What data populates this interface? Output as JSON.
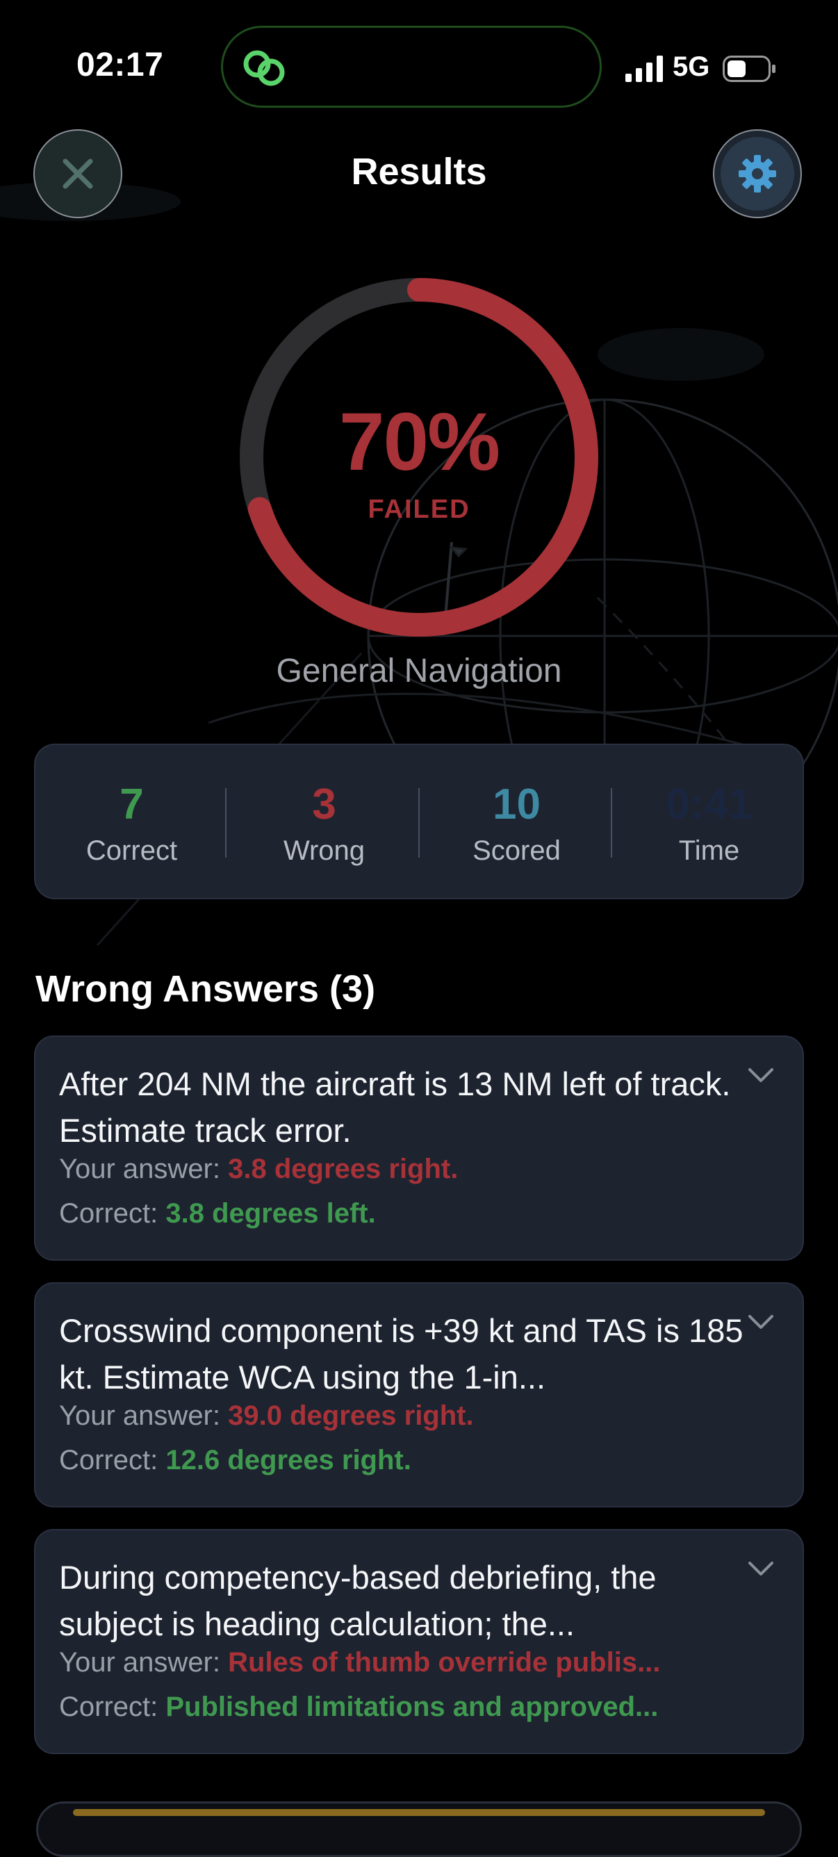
{
  "status_bar": {
    "time": "02:17",
    "network": "5G"
  },
  "header": {
    "title": "Results",
    "close_icon": "close-icon",
    "settings_icon": "gear-icon"
  },
  "result": {
    "score": "70%",
    "status": "FAILED",
    "subject": "General Navigation",
    "progress_fraction": 0.7,
    "accent_color": "#a73238"
  },
  "stats": [
    {
      "value": "7",
      "label": "Correct",
      "color": "#3f9a50"
    },
    {
      "value": "3",
      "label": "Wrong",
      "color": "#a73238"
    },
    {
      "value": "10",
      "label": "Scored",
      "color": "#3e8aa3"
    },
    {
      "value": "0:41",
      "label": "Time",
      "color": "#1a2540"
    }
  ],
  "wrong_answers": {
    "title": "Wrong Answers (3)",
    "your_answer_label": "Your answer:",
    "correct_label": "Correct:",
    "items": [
      {
        "question": "After 204 NM the aircraft is 13 NM left of track. Estimate track error.",
        "your_answer": "3.8 degrees right.",
        "correct": "3.8 degrees left."
      },
      {
        "question": "Crosswind component is +39 kt and TAS is 185 kt. Estimate WCA using the 1-in...",
        "your_answer": "39.0 degrees right.",
        "correct": "12.6 degrees right."
      },
      {
        "question": "During competency-based debriefing, the subject is heading calculation; the...",
        "your_answer": "Rules of thumb override publis...",
        "correct": "Published limitations and approved..."
      }
    ]
  }
}
